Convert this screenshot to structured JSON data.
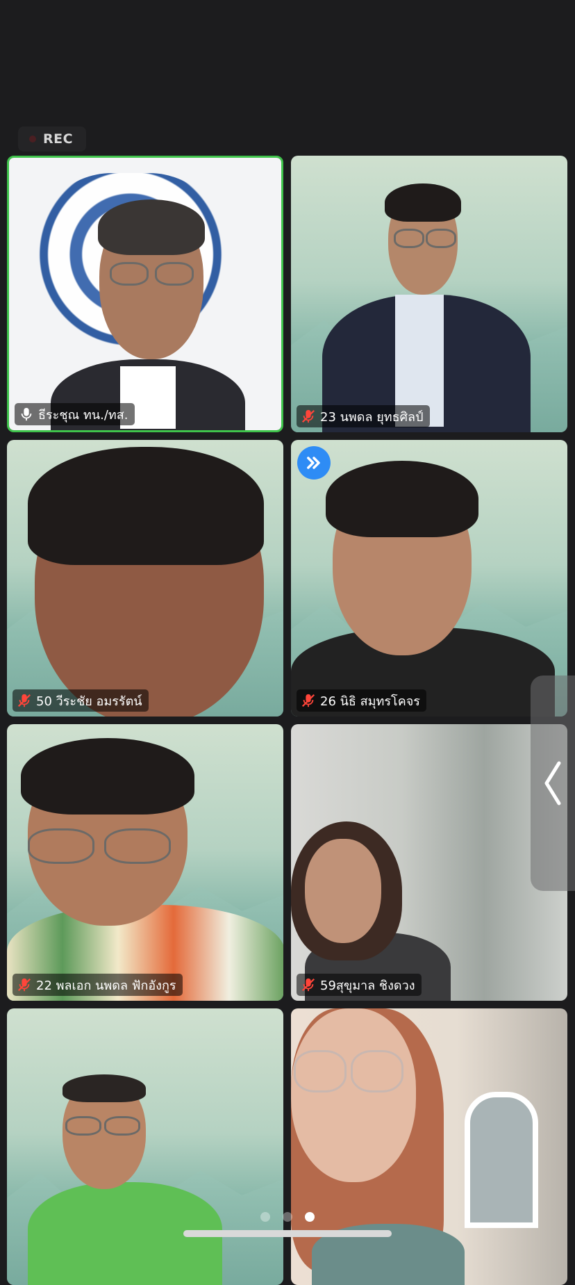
{
  "recording": {
    "label": "REC"
  },
  "participants": [
    {
      "name": "ธีระชุณ ทน./ทส.",
      "mic": "active",
      "speaking": true
    },
    {
      "name": "23 นพดล ยุทธศิลป์",
      "mic": "muted"
    },
    {
      "name": "50 วีระชัย อมรรัตน์",
      "mic": "muted"
    },
    {
      "name": "26 นิธิ สมุทรโคจร",
      "mic": "muted",
      "spotlight": true
    },
    {
      "name": "22 พลเอก นพดล ฟักอังกูร",
      "mic": "muted"
    },
    {
      "name": "59สุขุมาล ชิงดวง",
      "mic": "muted"
    },
    {
      "name": "",
      "mic": "none"
    },
    {
      "name": "",
      "mic": "none"
    }
  ],
  "icons": {
    "muted_mic": "muted-mic-icon",
    "active_mic": "active-mic-icon",
    "spotlight": "spotlight-icon",
    "side_panel": "chevron-left-icon"
  },
  "pagination": {
    "pages": 3,
    "current": 3
  },
  "colors": {
    "background": "#1c1c1e",
    "speaking_border": "#3fc34b",
    "muted_icon": "#ff453a",
    "spotlight": "#2e8cf5"
  }
}
